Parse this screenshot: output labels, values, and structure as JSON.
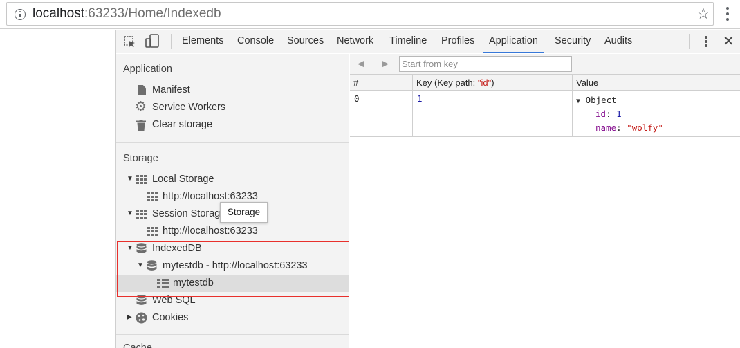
{
  "browser": {
    "url_host": "localhost",
    "url_rest": ":63233/Home/Indexedb"
  },
  "devtools": {
    "tabs": [
      {
        "label": "Elements"
      },
      {
        "label": "Console"
      },
      {
        "label": "Sources"
      },
      {
        "label": "Network"
      },
      {
        "label": "Timeline"
      },
      {
        "label": "Profiles"
      },
      {
        "label": "Application",
        "active": true
      },
      {
        "label": "Security"
      },
      {
        "label": "Audits"
      }
    ],
    "close_glyph": "✕"
  },
  "sidebar": {
    "application_title": "Application",
    "application_items": [
      "Manifest",
      "Service Workers",
      "Clear storage"
    ],
    "storage_title": "Storage",
    "local_storage": "Local Storage",
    "local_storage_child": "http://localhost:63233",
    "session_storage": "Session Storage",
    "session_storage_child": "http://localhost:63233",
    "indexeddb": "IndexedDB",
    "indexeddb_db": "mytestdb - http://localhost:63233",
    "indexeddb_store": "mytestdb",
    "web_sql": "Web SQL",
    "cookies": "Cookies",
    "cache_partial": "Cache"
  },
  "tooltip": "Storage",
  "main": {
    "key_placeholder": "Start from key",
    "columns": {
      "index": "#",
      "key_prefix": "Key (Key path: ",
      "key_path": "\"id\"",
      "key_suffix": ")",
      "value": "Value"
    },
    "rows": [
      {
        "index": "0",
        "key": "1",
        "value_type": "Object",
        "props": [
          {
            "name": "id",
            "value": "1",
            "kind": "number"
          },
          {
            "name": "name",
            "value": "\"wolfy\"",
            "kind": "string"
          }
        ]
      }
    ]
  },
  "colors": {
    "active_tab_underline": "#3879d9",
    "highlight_box": "#e8302c",
    "selected_row": "#dddddd"
  }
}
